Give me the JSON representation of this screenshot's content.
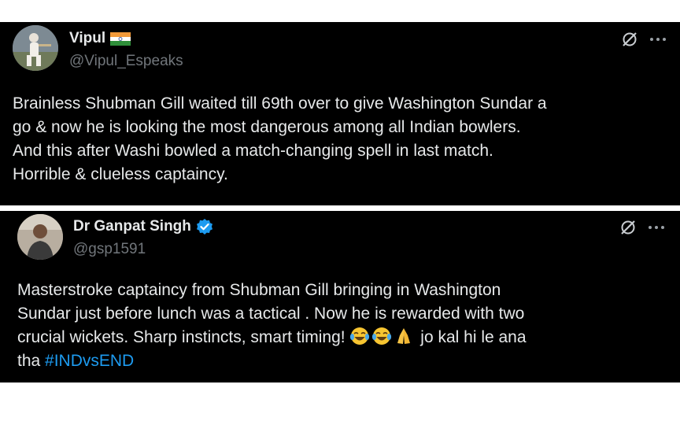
{
  "tweets": [
    {
      "display_name": "Vipul",
      "badge": "india-flag-icon",
      "handle": "@Vipul_Espeaks",
      "text_lines": [
        "Brainless Shubman Gill waited till 69th over to give Washington Sundar a",
        "go & now he is looking the most dangerous among all Indian bowlers.",
        "And this after Washi bowled a match-changing spell in last match.",
        "Horrible & clueless captaincy."
      ]
    },
    {
      "display_name": "Dr Ganpat Singh",
      "badge": "verified-badge-icon",
      "handle": "@gsp1591",
      "text_lines": [
        "Masterstroke captaincy from Shubman Gill bringing in Washington",
        "Sundar just before lunch was a tactical . Now he is rewarded with two"
      ],
      "line3_before_emoji": "crucial wickets. Sharp instincts, smart timing! ",
      "line3_emojis": [
        "face-with-tears-of-joy-icon",
        "face-with-tears-of-joy-icon",
        "folded-hands-icon"
      ],
      "line3_after_emoji": " jo kal hi le ana",
      "line4_text": "tha ",
      "hashtag": "#INDvsEND"
    }
  ],
  "colors": {
    "background": "#000000",
    "text": "#e7e9ea",
    "handle": "#71767b",
    "hashtag": "#1d9bf0",
    "verified": "#1d9bf0"
  },
  "icons": [
    "grok-icon",
    "more-options-icon"
  ]
}
